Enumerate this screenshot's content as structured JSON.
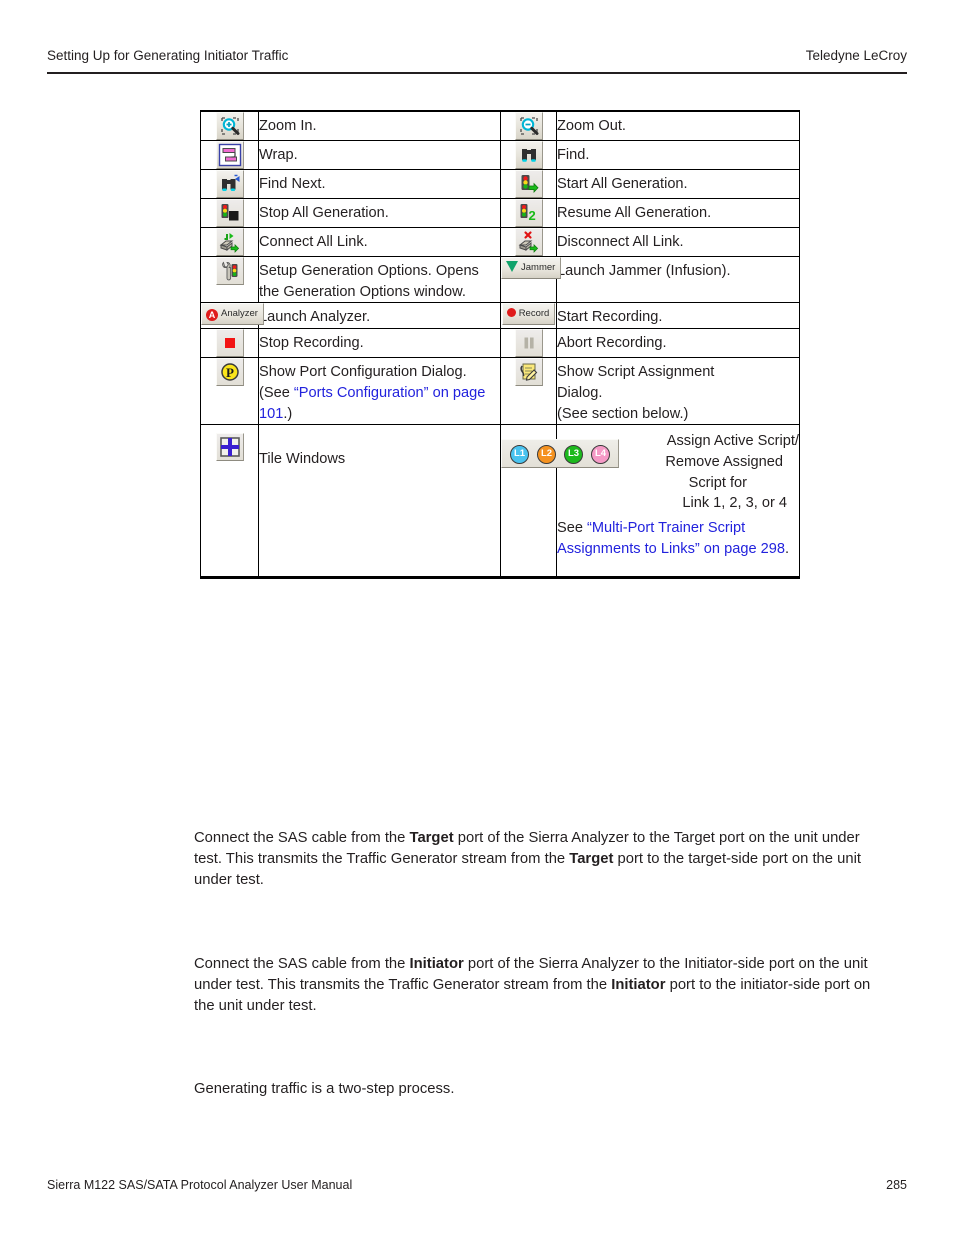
{
  "header": {
    "left": "Setting Up for Generating Initiator Traffic",
    "right": "Teledyne LeCroy"
  },
  "footer": {
    "left": "Sierra M122 SAS/SATA Protocol Analyzer User Manual",
    "page": "285"
  },
  "colors": {
    "link": "#2222dd",
    "text": "#231f20",
    "l1": "#49c3ef",
    "l2": "#f59220",
    "l3": "#1db91d",
    "l4": "#f59ac6",
    "record_dot": "#e01b1b",
    "stop_square": "#f21414",
    "port_yellow": "#fbe51a"
  },
  "table": {
    "rows": [
      {
        "left": {
          "icon": "zoom-in-icon",
          "text": "Zoom In."
        },
        "right": {
          "icon": "zoom-out-icon",
          "text": "Zoom Out."
        }
      },
      {
        "left": {
          "icon": "wrap-icon",
          "text": "Wrap."
        },
        "right": {
          "icon": "find-icon",
          "text": "Find."
        }
      },
      {
        "left": {
          "icon": "find-next-icon",
          "text": "Find Next."
        },
        "right": {
          "icon": "start-all-generation-icon",
          "text": "Start All Generation."
        }
      },
      {
        "left": {
          "icon": "stop-all-generation-icon",
          "text": "Stop All Generation."
        },
        "right": {
          "icon": "resume-all-generation-icon",
          "text": "Resume All Generation."
        }
      },
      {
        "left": {
          "icon": "connect-all-link-icon",
          "text": "Connect All Link."
        },
        "right": {
          "icon": "disconnect-all-link-icon",
          "text": "Disconnect All Link."
        }
      },
      {
        "left": {
          "icon": "setup-generation-options-icon",
          "text": "Setup Generation Options. Opens the Generation Options window."
        },
        "right": {
          "icon": "jammer-icon",
          "icon_label": "Jammer",
          "text": "Launch Jammer (Infusion)."
        }
      },
      {
        "left": {
          "icon": "launch-analyzer-icon",
          "icon_label": "Analyzer",
          "text": "Launch Analyzer."
        },
        "right": {
          "icon": "start-recording-icon",
          "icon_label": "Record",
          "text": "Start Recording."
        }
      },
      {
        "left": {
          "icon": "stop-recording-icon",
          "text": "Stop Recording."
        },
        "right": {
          "icon": "abort-recording-icon",
          "text": "Abort Recording."
        }
      },
      {
        "left": {
          "icon": "port-configuration-icon",
          "text_before": "Show Port Configuration Dialog. (See ",
          "link": "“Ports Configuration” on page 101",
          "text_after": ".)"
        },
        "right": {
          "icon": "script-assignment-icon",
          "line1": "Show Script Assignment",
          "line2": "Dialog.",
          "line3": "(See section below.)"
        }
      },
      {
        "left": {
          "icon": "tile-windows-icon",
          "text": "Tile Windows"
        },
        "right": {
          "icon": "link-script-buttons-icon",
          "link_buttons": [
            "L1",
            "L2",
            "L3",
            "L4"
          ],
          "line1": "Assign Active Script/",
          "line2": "Remove Assigned",
          "line3": "Script for",
          "line4": "Link 1, 2, 3, or 4",
          "see_label": "See ",
          "link": "“Multi-Port Trainer Script Assignments to Links” on page 298",
          "link_tail": "."
        }
      }
    ]
  },
  "body": {
    "target_paragraph": {
      "p1": "Connect the SAS cable from the ",
      "b1": "Target",
      "p2": " port of the Sierra Analyzer to the Target port on the unit under test. This transmits the Traffic Generator stream from the ",
      "b2": "Target",
      "p3": " port to the target-side port on the unit under test."
    },
    "initiator_paragraph": {
      "p1": "Connect the SAS cable from the ",
      "b1": "Initiator",
      "p2": " port of the Sierra Analyzer to the Initiator-side port on the unit under test. This transmits the Traffic Generator stream from the ",
      "b2": "Initiator",
      "p3": " port to the initiator-side port on the unit under test."
    },
    "two_step": "Generating traffic is a two-step process."
  }
}
